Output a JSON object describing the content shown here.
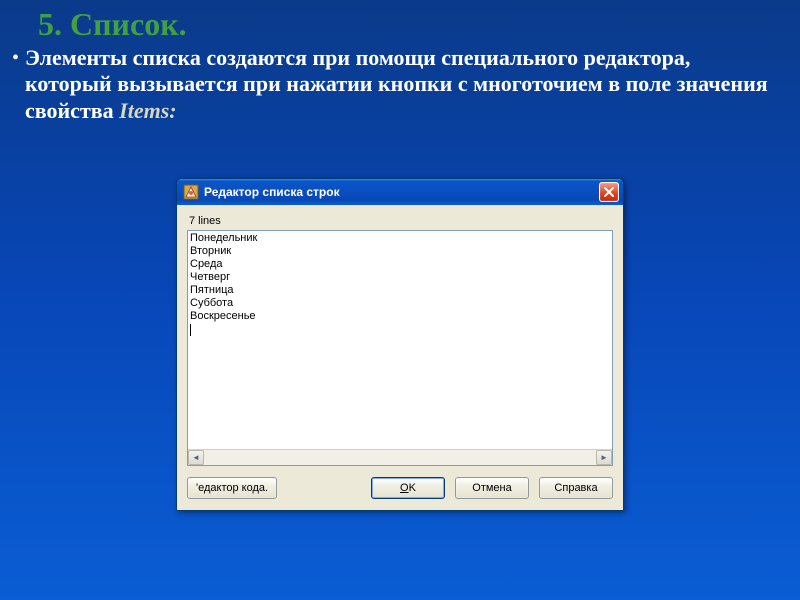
{
  "slide": {
    "title": "5. Список.",
    "body_part1": "Элементы списка создаются при помощи специального редактора, который вызывается при нажатии кнопки с многоточием в поле значения свойства ",
    "body_italic": "Items:"
  },
  "dialog": {
    "title": "Редактор списка строк",
    "lines_label": "7 lines",
    "content": "Понедельник\nВторник\nСреда\nЧетверг\nПятница\nСуббота\nВоскресенье",
    "buttons": {
      "code_editor": "'едактор кода.",
      "ok_prefix": "O",
      "ok_rest": "K",
      "cancel": "Отмена",
      "help": "Справка"
    },
    "icons": {
      "app": "delphi-icon",
      "close": "close-icon",
      "scroll_left": "◄",
      "scroll_right": "►"
    }
  }
}
